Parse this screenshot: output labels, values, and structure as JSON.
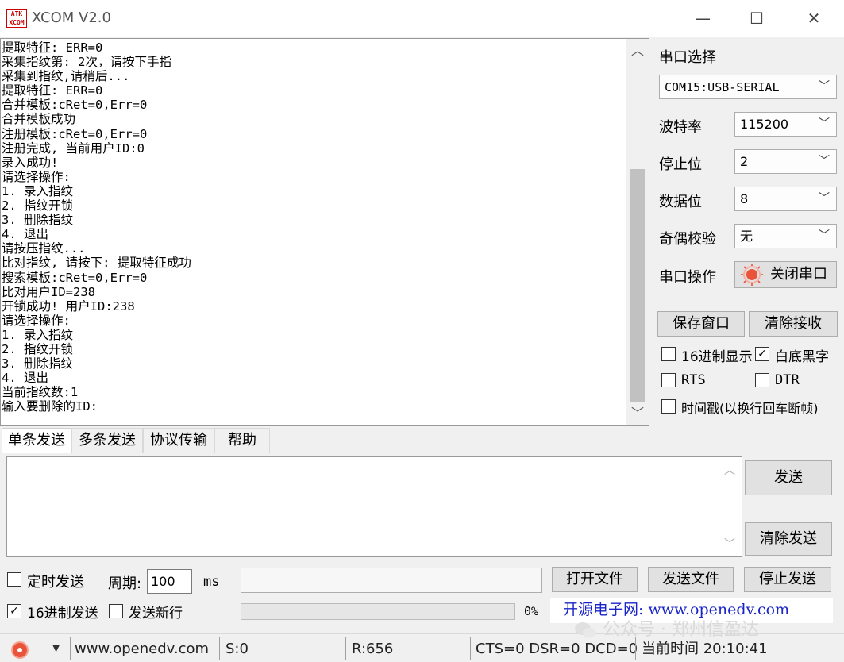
{
  "titlebar": {
    "logo_text": "ATK XCOM",
    "title": "XCOM V2.0",
    "minimize": "—",
    "maximize": "☐",
    "close": "✕"
  },
  "receive": {
    "lines": [
      "提取特征: ERR=0",
      "采集指纹第: 2次，请按下手指",
      "采集到指纹,请稍后...",
      "提取特征: ERR=0",
      "合并模板:cRet=0,Err=0",
      "合并模板成功",
      "注册模板:cRet=0,Err=0",
      "注册完成, 当前用户ID:0",
      "录入成功!",
      "请选择操作:",
      "1. 录入指纹",
      "2. 指纹开锁",
      "3. 删除指纹",
      "4. 退出",
      "请按压指纹...",
      "比对指纹, 请按下: 提取特征成功",
      "搜索模板:cRet=0,Err=0",
      "比对用户ID=238",
      "开锁成功! 用户ID:238",
      "请选择操作:",
      "1. 录入指纹",
      "2. 指纹开锁",
      "3. 删除指纹",
      "4. 退出",
      "当前指纹数:1",
      "输入要删除的ID:"
    ],
    "scroll_up": "︿",
    "scroll_down": "﹀"
  },
  "serial": {
    "port_label": "串口选择",
    "port_value": "COM15:USB-SERIAL",
    "baud_label": "波特率",
    "baud_value": "115200",
    "stop_label": "停止位",
    "stop_value": "2",
    "data_label": "数据位",
    "data_value": "8",
    "parity_label": "奇偶校验",
    "parity_value": "无",
    "op_label": "串口操作",
    "op_button": "关闭串口",
    "chevron": "﹀"
  },
  "receive_options": {
    "save_window": "保存窗口",
    "clear_receive": "清除接收",
    "hex_display": "16进制显示",
    "hex_display_checked": false,
    "white_black": "白底黑字",
    "white_black_checked": true,
    "rts": "RTS",
    "rts_checked": false,
    "dtr": "DTR",
    "dtr_checked": false,
    "timestamp": "时间戳(以换行回车断帧)",
    "timestamp_checked": false
  },
  "tabs": [
    "单条发送",
    "多条发送",
    "协议传输",
    "帮助"
  ],
  "send": {
    "send_button": "发送",
    "clear_send": "清除发送",
    "timed_send": "定时发送",
    "timed_send_checked": false,
    "period_label": "周期:",
    "period_value": "100",
    "period_unit": "ms",
    "open_file": "打开文件",
    "send_file": "发送文件",
    "stop_send": "停止发送",
    "hex_send": "16进制发送",
    "hex_send_checked": true,
    "new_line": "发送新行",
    "new_line_checked": false,
    "progress_text": "0%",
    "progress_value": 0,
    "scroll_up": "︿",
    "scroll_down": "﹀"
  },
  "watermark": "开源电子网: www.openedv.com",
  "statusbar": {
    "dropdown": "▼",
    "site": "www.openedv.com",
    "sent": "S:0",
    "received": "R:656",
    "lines_state": "CTS=0 DSR=0 DCD=0",
    "time": "当前时间 20:10:41"
  },
  "wechat": "公众号 · 郑州信盈达",
  "colors": {
    "progress": "#06b025",
    "watermark": "#1a25c8",
    "led": "#e8533a"
  }
}
